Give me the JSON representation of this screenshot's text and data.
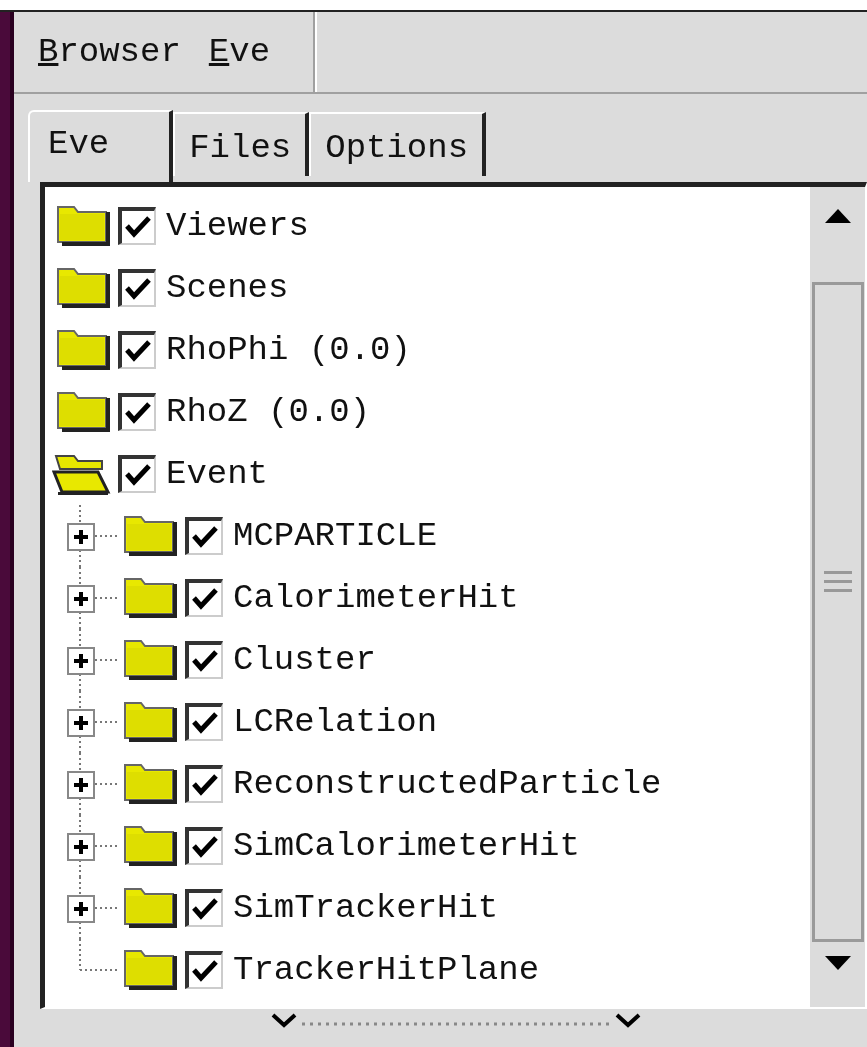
{
  "menu": [
    {
      "label": "Browser"
    },
    {
      "label": "Eve"
    }
  ],
  "tabs": [
    {
      "label": "Eve",
      "selected": true
    },
    {
      "label": "Files",
      "selected": false
    },
    {
      "label": "Options",
      "selected": false
    }
  ],
  "tree": [
    {
      "label": "Viewers",
      "checked": true,
      "expanded": false
    },
    {
      "label": "Scenes",
      "checked": true,
      "expanded": false
    },
    {
      "label": "RhoPhi (0.0)",
      "checked": true,
      "expanded": false
    },
    {
      "label": "RhoZ (0.0)",
      "checked": true,
      "expanded": false
    },
    {
      "label": "Event",
      "checked": true,
      "expanded": true,
      "children": [
        {
          "label": "MCPARTICLE",
          "checked": true,
          "expanded": false,
          "has_children": true
        },
        {
          "label": "CalorimeterHit",
          "checked": true,
          "expanded": false,
          "has_children": true
        },
        {
          "label": "Cluster",
          "checked": true,
          "expanded": false,
          "has_children": true
        },
        {
          "label": "LCRelation",
          "checked": true,
          "expanded": false,
          "has_children": true
        },
        {
          "label": "ReconstructedParticle",
          "checked": true,
          "expanded": false,
          "has_children": true
        },
        {
          "label": "SimCalorimeterHit",
          "checked": true,
          "expanded": false,
          "has_children": true
        },
        {
          "label": "SimTrackerHit",
          "checked": true,
          "expanded": false,
          "has_children": true
        },
        {
          "label": "TrackerHitPlane",
          "checked": true,
          "expanded": false,
          "has_children": false
        }
      ]
    }
  ]
}
